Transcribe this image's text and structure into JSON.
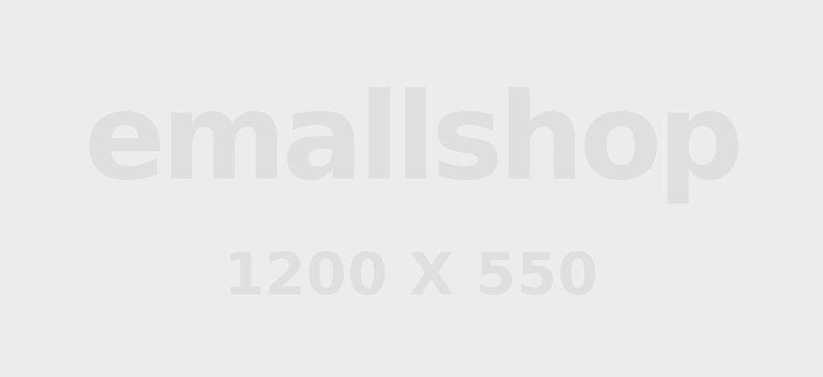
{
  "placeholder": {
    "brand": "emallshop",
    "dimensions": "1200 X 550"
  },
  "colors": {
    "background": "#ececec",
    "text": "#dfdfdf"
  }
}
